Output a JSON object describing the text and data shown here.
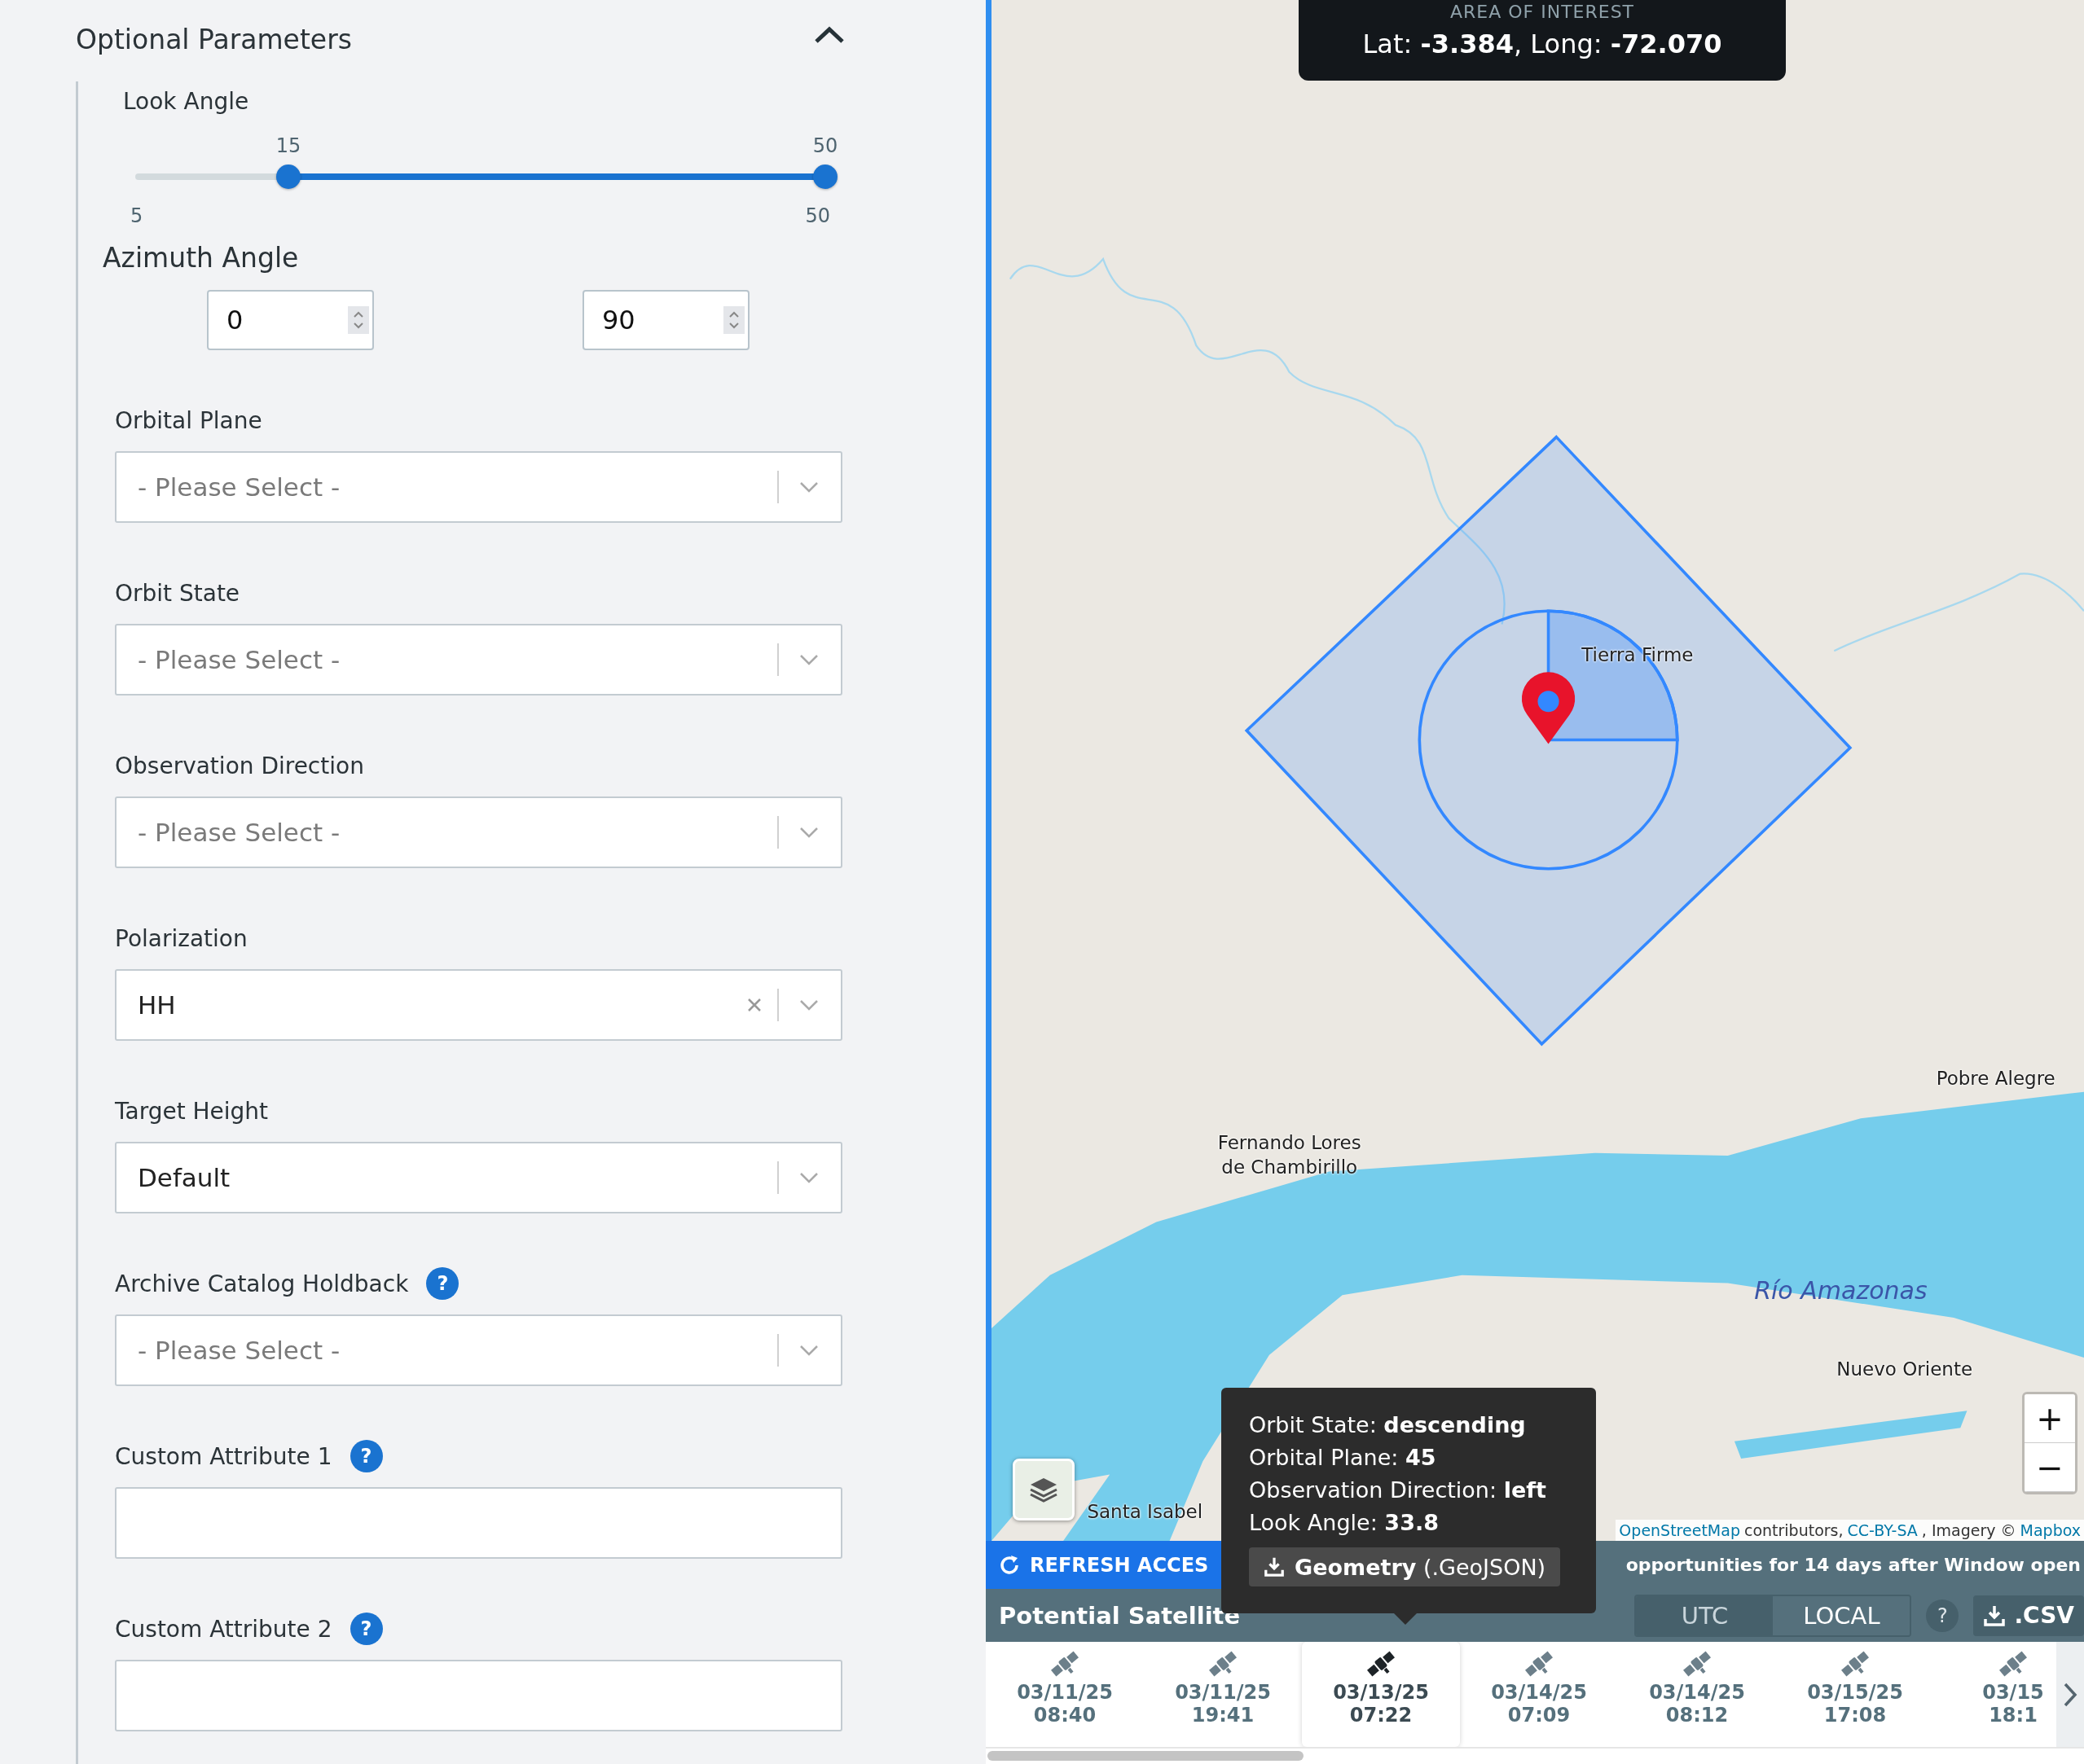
{
  "panel": {
    "title": "Optional Parameters",
    "expanded": true,
    "look_angle": {
      "label": "Look Angle",
      "thumbs": [
        {
          "reading": "15",
          "level": 0.222
        },
        {
          "reading": "50",
          "level": 1
        }
      ],
      "min": "5",
      "max": "50"
    },
    "azimuth": {
      "label": "Azimuth Angle",
      "inputs": [
        "0",
        "90"
      ]
    },
    "fields": [
      {
        "label": "Orbital Plane",
        "kind": "select",
        "placeholder": "- Please Select -"
      },
      {
        "label": "Orbit State",
        "kind": "select",
        "placeholder": "- Please Select -"
      },
      {
        "label": "Observation Direction",
        "kind": "select",
        "placeholder": "- Please Select -"
      },
      {
        "label": "Polarization",
        "kind": "select",
        "value": "HH",
        "clearable": true
      },
      {
        "label": "Target Height",
        "kind": "select",
        "value": "Default"
      },
      {
        "label": "Archive Catalog Holdback",
        "help": "?",
        "kind": "select",
        "placeholder": "- Please Select -"
      },
      {
        "label": "Custom Attribute 1",
        "help": "?",
        "kind": "text"
      },
      {
        "label": "Custom Attribute 2",
        "help": "?",
        "kind": "text"
      }
    ]
  },
  "map": {
    "aoi": {
      "title": "AREA OF INTEREST",
      "coords": "Lat: **-3.384**, Long: **-72.070**"
    },
    "labels": [
      {
        "text": "Tierra Firme",
        "kind": "place"
      },
      {
        "text": "Pobre Alegre",
        "kind": "place"
      },
      {
        "text": "Fernando Lores de Chambirillo",
        "kind": "place"
      },
      {
        "text": "Río Amazonas",
        "kind": "water"
      },
      {
        "text": "Nuevo Oriente",
        "kind": "place"
      },
      {
        "text": "Santa Isabel",
        "kind": "place"
      }
    ],
    "zoom": [
      "+",
      "−"
    ],
    "attribution": [
      {
        "text": "OpenStreetMap",
        "link": true
      },
      {
        "text": "contributors,",
        "link": false
      },
      {
        "text": "CC-BY-SA",
        "link": true
      },
      {
        "text": ", Imagery ©",
        "link": false
      },
      {
        "text": "Mapbox",
        "link": true
      }
    ]
  },
  "tooltip": {
    "lines": [
      {
        "label": "Orbit State:",
        "value": "descending"
      },
      {
        "label": "Orbital Plane:",
        "value": "45"
      },
      {
        "label": "Observation Direction:",
        "value": "left"
      },
      {
        "label": "Look Angle:",
        "value": "33.8"
      }
    ],
    "button": "**Geometry** (.GeoJSON)"
  },
  "refresh_bar": {
    "button": "REFRESH ACCES",
    "info": "opportunities for 14 days after Window open"
  },
  "access": {
    "title": "Potential Satellite",
    "toggle": [
      {
        "label": "UTC",
        "selected": true
      },
      {
        "label": "LOCAL",
        "selected": false
      }
    ],
    "help2": "?",
    "csv": ".CSV"
  },
  "timeline": [
    {
      "date": "03/11/25",
      "time": "08:40",
      "selected": false
    },
    {
      "date": "03/11/25",
      "time": "19:41",
      "selected": false
    },
    {
      "date": "03/13/25",
      "time": "07:22",
      "selected": true
    },
    {
      "date": "03/14/25",
      "time": "07:09",
      "selected": false
    },
    {
      "date": "03/14/25",
      "time": "08:12",
      "selected": false
    },
    {
      "date": "03/15/25",
      "time": "17:08",
      "selected": false
    },
    {
      "date": "03/15",
      "time": "18:1",
      "selected": false
    }
  ]
}
